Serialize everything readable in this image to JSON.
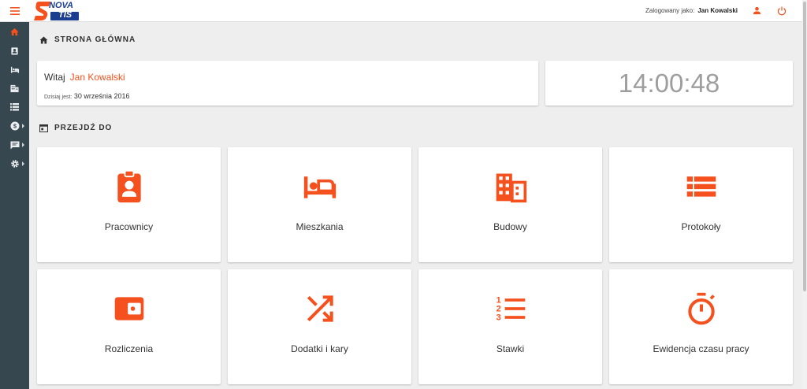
{
  "colors": {
    "accent": "#f4511e",
    "sidebar": "#37474f",
    "brand_blue": "#1a3d8f",
    "brand_orange": "#f4511e"
  },
  "logo": {
    "text_top": "NOVA",
    "text_bottom": "TIS"
  },
  "header": {
    "logged_in_label": "Zalogowany jako:",
    "user_name": "Jan Kowalski",
    "icons": [
      "user-icon",
      "power-icon"
    ]
  },
  "sidebar": {
    "items": [
      {
        "icon": "home-icon",
        "active": true,
        "submenu": false
      },
      {
        "icon": "badge-icon",
        "active": false,
        "submenu": false
      },
      {
        "icon": "bed-icon",
        "active": false,
        "submenu": false
      },
      {
        "icon": "building-icon",
        "active": false,
        "submenu": false
      },
      {
        "icon": "list-icon",
        "active": false,
        "submenu": false
      },
      {
        "icon": "dollar-icon",
        "active": false,
        "submenu": true
      },
      {
        "icon": "message-icon",
        "active": false,
        "submenu": true
      },
      {
        "icon": "gear-icon",
        "active": false,
        "submenu": true
      }
    ]
  },
  "main": {
    "home_title": "STRONA GŁÓWNA",
    "welcome": {
      "greeting": "Witaj",
      "name": "Jan Kowalski",
      "today_label": "Dzisiaj jest:",
      "date": "30 września 2016"
    },
    "clock": "14:00:48",
    "goto_title": "PRZEJDŹ DO",
    "tiles": [
      {
        "label": "Pracownicy",
        "icon": "badge-icon"
      },
      {
        "label": "Mieszkania",
        "icon": "bed-icon"
      },
      {
        "label": "Budowy",
        "icon": "building-icon"
      },
      {
        "label": "Protokoły",
        "icon": "list-icon"
      },
      {
        "label": "Rozliczenia",
        "icon": "wallet-icon"
      },
      {
        "label": "Dodatki i kary",
        "icon": "shuffle-icon"
      },
      {
        "label": "Stawki",
        "icon": "numbered-list-icon"
      },
      {
        "label": "Ewidencja czasu pracy",
        "icon": "timer-icon"
      }
    ]
  }
}
